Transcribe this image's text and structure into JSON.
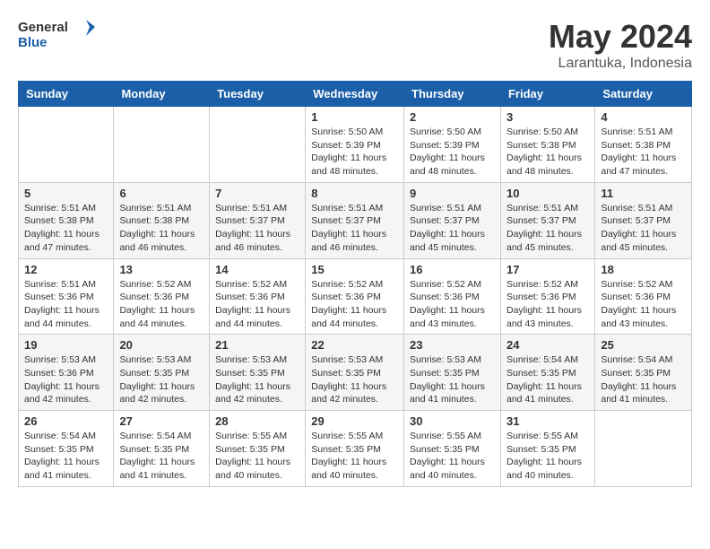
{
  "header": {
    "logo_general": "General",
    "logo_blue": "Blue",
    "title": "May 2024",
    "location": "Larantuka, Indonesia"
  },
  "days_of_week": [
    "Sunday",
    "Monday",
    "Tuesday",
    "Wednesday",
    "Thursday",
    "Friday",
    "Saturday"
  ],
  "weeks": [
    [
      {
        "day": "",
        "info": ""
      },
      {
        "day": "",
        "info": ""
      },
      {
        "day": "",
        "info": ""
      },
      {
        "day": "1",
        "info": "Sunrise: 5:50 AM\nSunset: 5:39 PM\nDaylight: 11 hours\nand 48 minutes."
      },
      {
        "day": "2",
        "info": "Sunrise: 5:50 AM\nSunset: 5:39 PM\nDaylight: 11 hours\nand 48 minutes."
      },
      {
        "day": "3",
        "info": "Sunrise: 5:50 AM\nSunset: 5:38 PM\nDaylight: 11 hours\nand 48 minutes."
      },
      {
        "day": "4",
        "info": "Sunrise: 5:51 AM\nSunset: 5:38 PM\nDaylight: 11 hours\nand 47 minutes."
      }
    ],
    [
      {
        "day": "5",
        "info": "Sunrise: 5:51 AM\nSunset: 5:38 PM\nDaylight: 11 hours\nand 47 minutes."
      },
      {
        "day": "6",
        "info": "Sunrise: 5:51 AM\nSunset: 5:38 PM\nDaylight: 11 hours\nand 46 minutes."
      },
      {
        "day": "7",
        "info": "Sunrise: 5:51 AM\nSunset: 5:37 PM\nDaylight: 11 hours\nand 46 minutes."
      },
      {
        "day": "8",
        "info": "Sunrise: 5:51 AM\nSunset: 5:37 PM\nDaylight: 11 hours\nand 46 minutes."
      },
      {
        "day": "9",
        "info": "Sunrise: 5:51 AM\nSunset: 5:37 PM\nDaylight: 11 hours\nand 45 minutes."
      },
      {
        "day": "10",
        "info": "Sunrise: 5:51 AM\nSunset: 5:37 PM\nDaylight: 11 hours\nand 45 minutes."
      },
      {
        "day": "11",
        "info": "Sunrise: 5:51 AM\nSunset: 5:37 PM\nDaylight: 11 hours\nand 45 minutes."
      }
    ],
    [
      {
        "day": "12",
        "info": "Sunrise: 5:51 AM\nSunset: 5:36 PM\nDaylight: 11 hours\nand 44 minutes."
      },
      {
        "day": "13",
        "info": "Sunrise: 5:52 AM\nSunset: 5:36 PM\nDaylight: 11 hours\nand 44 minutes."
      },
      {
        "day": "14",
        "info": "Sunrise: 5:52 AM\nSunset: 5:36 PM\nDaylight: 11 hours\nand 44 minutes."
      },
      {
        "day": "15",
        "info": "Sunrise: 5:52 AM\nSunset: 5:36 PM\nDaylight: 11 hours\nand 44 minutes."
      },
      {
        "day": "16",
        "info": "Sunrise: 5:52 AM\nSunset: 5:36 PM\nDaylight: 11 hours\nand 43 minutes."
      },
      {
        "day": "17",
        "info": "Sunrise: 5:52 AM\nSunset: 5:36 PM\nDaylight: 11 hours\nand 43 minutes."
      },
      {
        "day": "18",
        "info": "Sunrise: 5:52 AM\nSunset: 5:36 PM\nDaylight: 11 hours\nand 43 minutes."
      }
    ],
    [
      {
        "day": "19",
        "info": "Sunrise: 5:53 AM\nSunset: 5:36 PM\nDaylight: 11 hours\nand 42 minutes."
      },
      {
        "day": "20",
        "info": "Sunrise: 5:53 AM\nSunset: 5:35 PM\nDaylight: 11 hours\nand 42 minutes."
      },
      {
        "day": "21",
        "info": "Sunrise: 5:53 AM\nSunset: 5:35 PM\nDaylight: 11 hours\nand 42 minutes."
      },
      {
        "day": "22",
        "info": "Sunrise: 5:53 AM\nSunset: 5:35 PM\nDaylight: 11 hours\nand 42 minutes."
      },
      {
        "day": "23",
        "info": "Sunrise: 5:53 AM\nSunset: 5:35 PM\nDaylight: 11 hours\nand 41 minutes."
      },
      {
        "day": "24",
        "info": "Sunrise: 5:54 AM\nSunset: 5:35 PM\nDaylight: 11 hours\nand 41 minutes."
      },
      {
        "day": "25",
        "info": "Sunrise: 5:54 AM\nSunset: 5:35 PM\nDaylight: 11 hours\nand 41 minutes."
      }
    ],
    [
      {
        "day": "26",
        "info": "Sunrise: 5:54 AM\nSunset: 5:35 PM\nDaylight: 11 hours\nand 41 minutes."
      },
      {
        "day": "27",
        "info": "Sunrise: 5:54 AM\nSunset: 5:35 PM\nDaylight: 11 hours\nand 41 minutes."
      },
      {
        "day": "28",
        "info": "Sunrise: 5:55 AM\nSunset: 5:35 PM\nDaylight: 11 hours\nand 40 minutes."
      },
      {
        "day": "29",
        "info": "Sunrise: 5:55 AM\nSunset: 5:35 PM\nDaylight: 11 hours\nand 40 minutes."
      },
      {
        "day": "30",
        "info": "Sunrise: 5:55 AM\nSunset: 5:35 PM\nDaylight: 11 hours\nand 40 minutes."
      },
      {
        "day": "31",
        "info": "Sunrise: 5:55 AM\nSunset: 5:35 PM\nDaylight: 11 hours\nand 40 minutes."
      },
      {
        "day": "",
        "info": ""
      }
    ]
  ]
}
